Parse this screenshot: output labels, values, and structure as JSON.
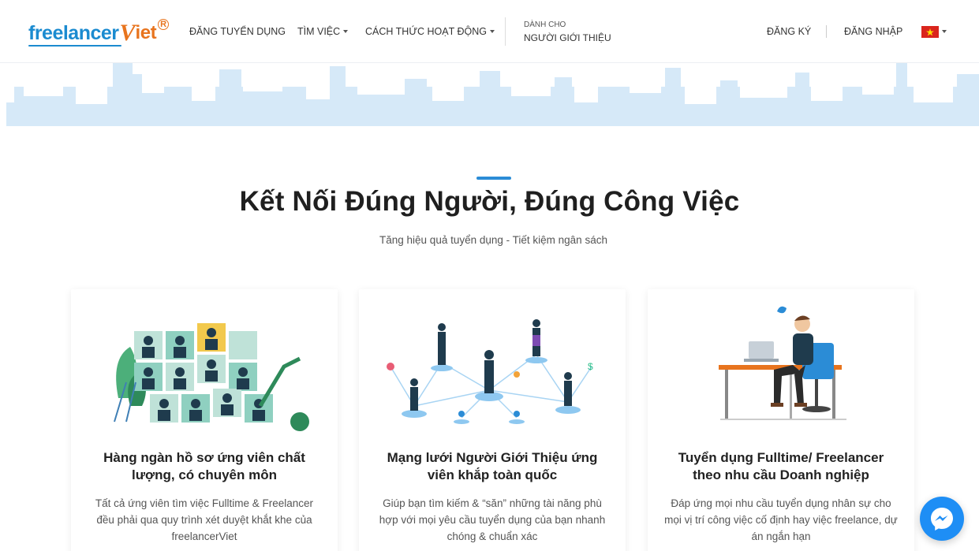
{
  "header": {
    "logo": {
      "part1": "freelancer",
      "part2": "V",
      "part3": "iet",
      "reg": "R"
    },
    "nav": {
      "post_job": "ĐĂNG TUYỂN DỤNG",
      "find_job": "TÌM VIỆC",
      "how_it_works": "CÁCH THỨC HOẠT ĐỘNG",
      "for_label": "DÀNH CHO",
      "for_referrer": "NGƯỜI GIỚI THIỆU",
      "register": "ĐĂNG KÝ",
      "login": "ĐĂNG NHẬP"
    },
    "language_flag": "vietnam-flag-icon"
  },
  "section": {
    "title": "Kết Nối Đúng Người, Đúng Công Việc",
    "subtitle": "Tăng hiệu quả tuyển dụng - Tiết kiệm ngân sách"
  },
  "cards": [
    {
      "illustration": "candidate-profiles-illustration",
      "title": "Hàng ngàn hồ sơ ứng viên chất lượng, có chuyên môn",
      "text": "Tất cả ứng viên tìm việc Fulltime & Freelancer đều phải qua quy trình xét duyệt khắt khe của freelancerViet"
    },
    {
      "illustration": "referrer-network-illustration",
      "title": "Mạng lưới Người Giới Thiệu ứng viên khắp toàn quốc",
      "text": "Giúp bạn tìm kiếm & “săn” những tài năng phù hợp với mọi yêu cầu tuyển dụng của bạn nhanh chóng & chuẩn xác"
    },
    {
      "illustration": "office-worker-illustration",
      "title": "Tuyển dụng Fulltime/ Freelancer theo nhu cầu Doanh nghiệp",
      "text": "Đáp ứng mọi nhu cầu tuyển dụng nhân sự cho mọi vị trí công việc cố định hay việc freelance, dự án ngắn hạn"
    }
  ],
  "colors": {
    "brand_blue": "#1b8bd0",
    "brand_orange": "#e8741e",
    "accent": "#2b8cd6",
    "skyline": "#d6e9f8",
    "messenger": "#1e8ef5"
  },
  "messenger": {
    "icon": "messenger-icon"
  }
}
